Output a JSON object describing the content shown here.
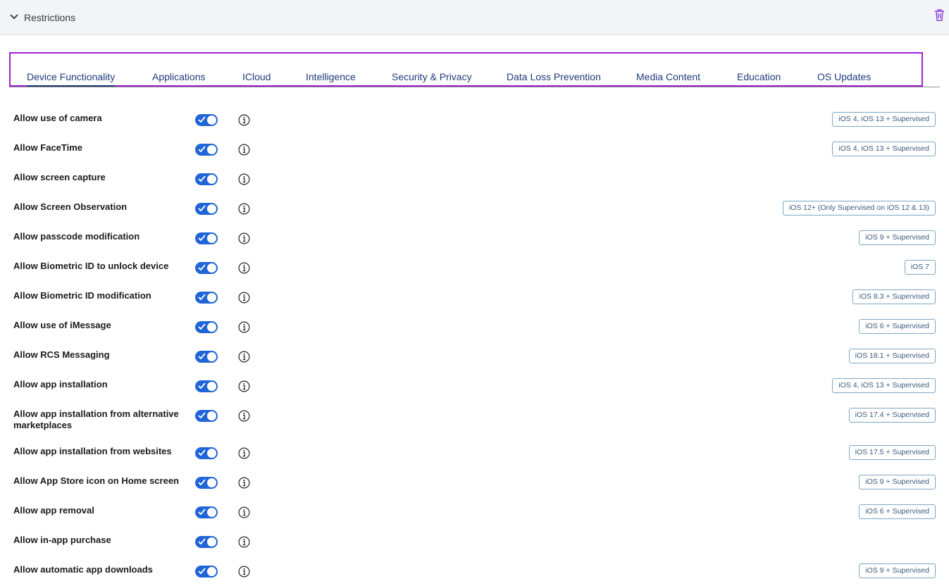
{
  "header": {
    "title": "Restrictions"
  },
  "tabs": [
    {
      "label": "Device Functionality",
      "active": true
    },
    {
      "label": "Applications"
    },
    {
      "label": "ICloud"
    },
    {
      "label": "Intelligence"
    },
    {
      "label": "Security & Privacy"
    },
    {
      "label": "Data Loss Prevention"
    },
    {
      "label": "Media Content"
    },
    {
      "label": "Education"
    },
    {
      "label": "OS Updates"
    }
  ],
  "settings": [
    {
      "label": "Allow use of camera",
      "enabled": true,
      "badge": "iOS 4, iOS 13 + Supervised"
    },
    {
      "label": "Allow FaceTime",
      "enabled": true,
      "badge": "iOS 4, iOS 13 + Supervised"
    },
    {
      "label": "Allow screen capture",
      "enabled": true,
      "badge": ""
    },
    {
      "label": "Allow Screen Observation",
      "enabled": true,
      "badge": "iOS 12+ (Only Supervised on iOS 12 & 13)"
    },
    {
      "label": "Allow passcode modification",
      "enabled": true,
      "badge": "iOS 9 + Supervised"
    },
    {
      "label": "Allow Biometric ID to unlock device",
      "enabled": true,
      "badge": "iOS 7"
    },
    {
      "label": "Allow Biometric ID modification",
      "enabled": true,
      "badge": "iOS 8.3 + Supervised"
    },
    {
      "label": "Allow use of iMessage",
      "enabled": true,
      "badge": "iOS 6 + Supervised"
    },
    {
      "label": "Allow RCS Messaging",
      "enabled": true,
      "badge": "iOS 18.1 + Supervised"
    },
    {
      "label": "Allow app installation",
      "enabled": true,
      "badge": "iOS 4, iOS 13 + Supervised"
    },
    {
      "label": "Allow app installation from alternative marketplaces",
      "enabled": true,
      "badge": "iOS 17.4 + Supervised"
    },
    {
      "label": "Allow app installation from websites",
      "enabled": true,
      "badge": "iOS 17.5 + Supervised"
    },
    {
      "label": "Allow App Store icon on Home screen",
      "enabled": true,
      "badge": "iOS 9 + Supervised"
    },
    {
      "label": "Allow app removal",
      "enabled": true,
      "badge": "iOS 6 + Supervised"
    },
    {
      "label": "Allow in-app purchase",
      "enabled": true,
      "badge": ""
    },
    {
      "label": "Allow automatic app downloads",
      "enabled": true,
      "badge": "iOS 9 + Supervised"
    }
  ],
  "icons": {
    "collapse": "chevron-down-icon",
    "delete": "trash-icon",
    "info": "info-circle-icon",
    "toggle_check": "check-icon"
  },
  "colors": {
    "tab_text": "#1f3a7a",
    "tabs_highlight_border": "#a11fd6",
    "toggle_on": "#2065d8",
    "trash": "#8a3fd6",
    "badge_border": "#7ea7c7"
  }
}
